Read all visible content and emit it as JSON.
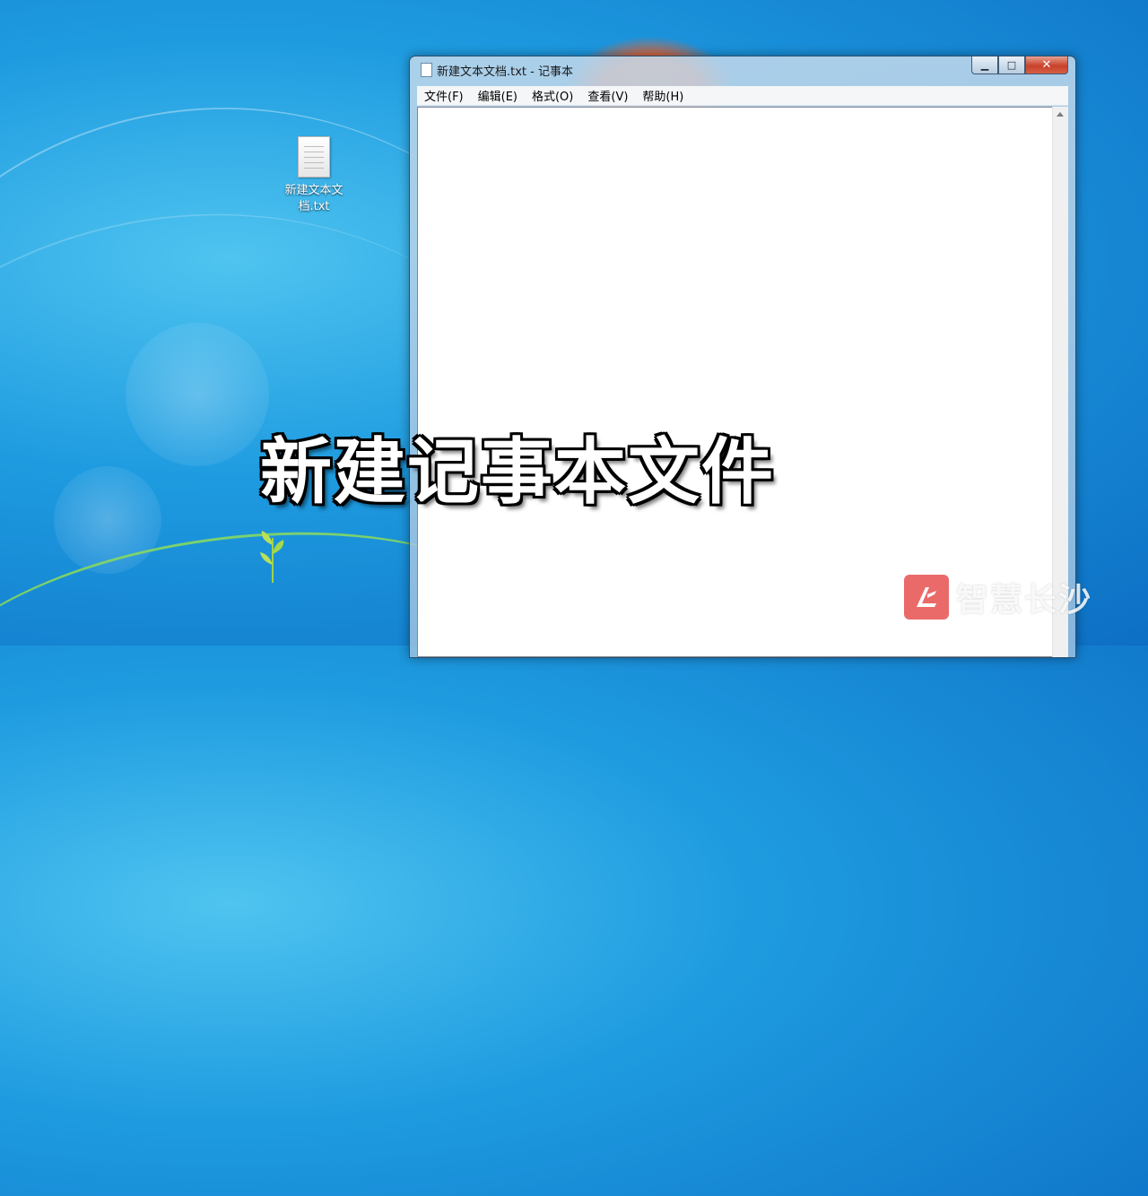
{
  "desktop": {
    "icon": {
      "name": "file-text-icon",
      "label": "新建文本文档.txt"
    }
  },
  "window": {
    "title": "新建文本文档.txt - 记事本",
    "controls": {
      "minimize": "▁",
      "maximize": "□",
      "close": "✕"
    },
    "menu": [
      "文件(F)",
      "编辑(E)",
      "格式(O)",
      "查看(V)",
      "帮助(H)"
    ],
    "editor_text": ""
  },
  "overlay": {
    "caption": "新建记事本文件",
    "watermark": "智慧长沙"
  },
  "colors": {
    "desktop_bg": "#1e9be0",
    "caption": "#ffffff",
    "close_button": "#c7422a",
    "watermark_logo": "#e65050"
  }
}
